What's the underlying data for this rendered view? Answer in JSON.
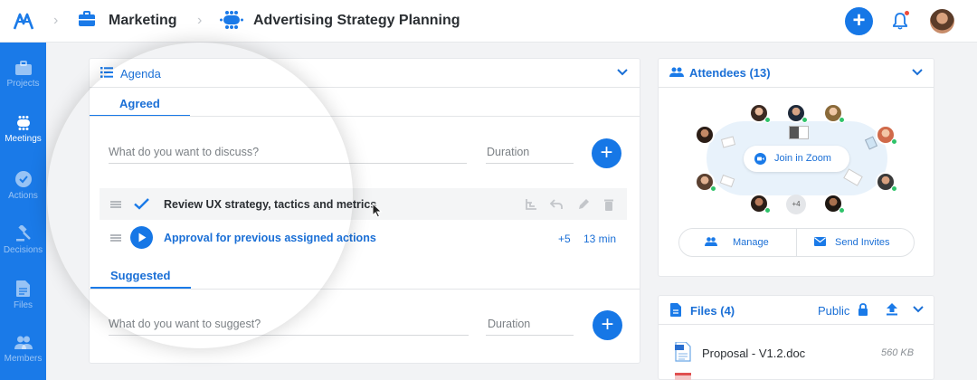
{
  "breadcrumb": {
    "project": "Marketing",
    "meeting": "Advertising Strategy Planning"
  },
  "sidebar": {
    "items": [
      {
        "label": "Projects",
        "icon": "briefcase-icon"
      },
      {
        "label": "Meetings",
        "icon": "meeting-table-icon",
        "active": true
      },
      {
        "label": "Actions",
        "icon": "check-circle-icon"
      },
      {
        "label": "Decisions",
        "icon": "gavel-icon"
      },
      {
        "label": "Files",
        "icon": "file-icon"
      },
      {
        "label": "Members",
        "icon": "people-icon"
      }
    ]
  },
  "agenda": {
    "title": "Agenda",
    "tabs": {
      "agreed": "Agreed",
      "suggested": "Suggested"
    },
    "discuss_placeholder": "What do you want to discuss?",
    "duration_placeholder": "Duration",
    "suggest_placeholder": "What do you want to suggest?",
    "items": [
      {
        "text": "Review UX strategy, tactics and metrics",
        "status": "done"
      },
      {
        "text": "Approval for previous assigned actions",
        "status": "in-progress",
        "extra": "+5",
        "duration": "13 min"
      }
    ]
  },
  "attendees": {
    "title": "Attendees (13)",
    "join_label": "Join in Zoom",
    "more_count": "+4",
    "manage_label": "Manage",
    "invite_label": "Send Invites"
  },
  "files": {
    "title": "Files (4)",
    "visibility": "Public",
    "items": [
      {
        "name": "Proposal - V1.2.doc",
        "size": "560 KB"
      }
    ]
  },
  "colors": {
    "brand": "#1a7ae8",
    "online": "#2fc36a",
    "notification": "#ef4b3b"
  }
}
